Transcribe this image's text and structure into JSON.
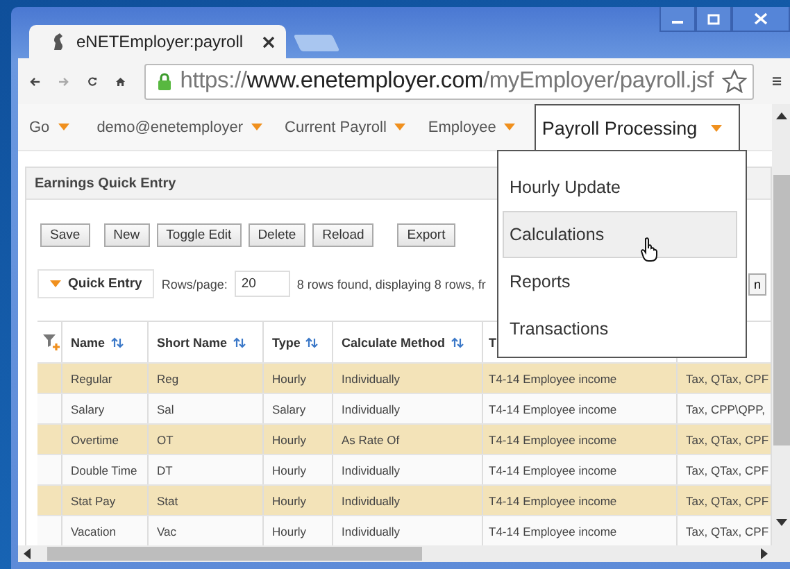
{
  "browser": {
    "tab_title": "eNETEmployer:payroll",
    "url_scheme": "https://",
    "url_host": "www.enetemployer.com",
    "url_path": "/myEmployer/payroll.jsf"
  },
  "nav": [
    {
      "label": "Go",
      "selected": false
    },
    {
      "label": "demo@enetemployer",
      "selected": false
    },
    {
      "label": "Current Payroll",
      "selected": false
    },
    {
      "label": "Employee",
      "selected": false
    },
    {
      "label": "Payroll Processing",
      "selected": true
    }
  ],
  "menu": [
    {
      "label": "Hourly Update",
      "selected": false
    },
    {
      "label": "Calculations",
      "selected": true
    },
    {
      "label": "Reports",
      "selected": false
    },
    {
      "label": "Transactions",
      "selected": false
    }
  ],
  "panel": {
    "title": "Earnings Quick Entry"
  },
  "buttons": [
    "Save",
    "New",
    "Toggle Edit",
    "Delete",
    "Reload",
    "Export"
  ],
  "quick_entry": {
    "label": "Quick Entry",
    "rows_label": "Rows/page:",
    "rows_value": "20",
    "status": "8 rows found, displaying 8 rows, fr",
    "right_button": "n"
  },
  "table": {
    "columns": [
      {
        "label": "Name",
        "sortable": true
      },
      {
        "label": "Short Name",
        "sortable": true
      },
      {
        "label": "Type",
        "sortable": true
      },
      {
        "label": "Calculate Method",
        "sortable": true
      },
      {
        "label": "T"
      }
    ],
    "rows": [
      [
        "Regular",
        "Reg",
        "Hourly",
        "Individually",
        "T4-14 Employee income",
        "Tax, QTax, CPF"
      ],
      [
        "Salary",
        "Sal",
        "Salary",
        "Individually",
        "T4-14 Employee income",
        "Tax, CPP\\QPP,"
      ],
      [
        "Overtime",
        "OT",
        "Hourly",
        "As Rate Of",
        "T4-14 Employee income",
        "Tax, QTax, CPF"
      ],
      [
        "Double Time",
        "DT",
        "Hourly",
        "Individually",
        "T4-14 Employee income",
        "Tax, QTax, CPF"
      ],
      [
        "Stat Pay",
        "Stat",
        "Hourly",
        "Individually",
        "T4-14 Employee income",
        "Tax, QTax, CPF"
      ],
      [
        "Vacation",
        "Vac",
        "Hourly",
        "Individually",
        "T4-14 Employee income",
        "Tax, QTax, CPF"
      ]
    ]
  }
}
